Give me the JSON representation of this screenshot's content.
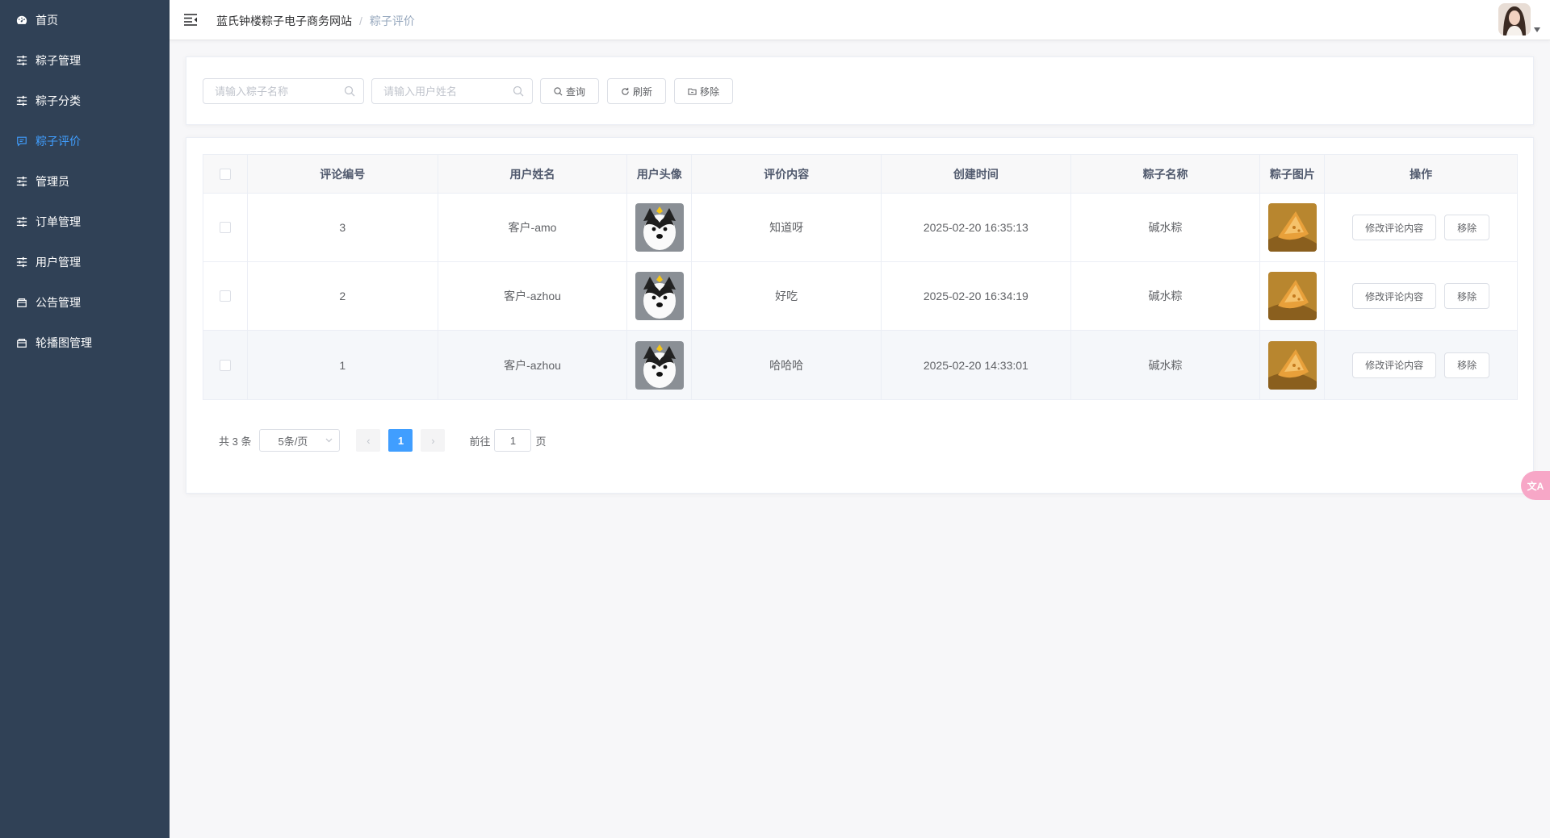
{
  "sidebar": {
    "items": [
      {
        "label": "首页",
        "icon": "dashboard-icon",
        "active": false
      },
      {
        "label": "粽子管理",
        "icon": "sliders-icon",
        "active": false
      },
      {
        "label": "粽子分类",
        "icon": "sliders-icon",
        "active": false
      },
      {
        "label": "粽子评价",
        "icon": "message-icon",
        "active": true
      },
      {
        "label": "管理员",
        "icon": "sliders-icon",
        "active": false
      },
      {
        "label": "订单管理",
        "icon": "sliders-icon",
        "active": false
      },
      {
        "label": "用户管理",
        "icon": "sliders-icon",
        "active": false
      },
      {
        "label": "公告管理",
        "icon": "box-icon",
        "active": false
      },
      {
        "label": "轮播图管理",
        "icon": "box-icon",
        "active": false
      }
    ],
    "colors": {
      "background": "#304156",
      "text": "#ffffff",
      "active": "#409eff"
    }
  },
  "header": {
    "breadcrumb_root": "蓝氏钟楼粽子电子商务网站",
    "breadcrumb_sep": "/",
    "breadcrumb_current": "粽子评价"
  },
  "search": {
    "name_placeholder": "请输入粽子名称",
    "user_placeholder": "请输入用户姓名",
    "query_label": "查询",
    "refresh_label": "刷新",
    "remove_label": "移除"
  },
  "table": {
    "columns": [
      "评论编号",
      "用户姓名",
      "用户头像",
      "评价内容",
      "创建时间",
      "粽子名称",
      "粽子图片",
      "操作"
    ],
    "rows": [
      {
        "id": "3",
        "user": "客户-amo",
        "content": "知道呀",
        "created": "2025-02-20 16:35:13",
        "product": "碱水粽"
      },
      {
        "id": "2",
        "user": "客户-azhou",
        "content": "好吃",
        "created": "2025-02-20 16:34:19",
        "product": "碱水粽"
      },
      {
        "id": "1",
        "user": "客户-azhou",
        "content": "哈哈哈",
        "created": "2025-02-20 14:33:01",
        "product": "碱水粽"
      }
    ],
    "edit_label": "修改评论内容",
    "delete_label": "移除"
  },
  "pagination": {
    "total_text": "共 3 条",
    "page_size": "5条/页",
    "prev": "‹",
    "next": "›",
    "current_page": "1",
    "goto_label": "前往",
    "goto_value": "1",
    "page_unit": "页"
  },
  "float_button": "文A"
}
